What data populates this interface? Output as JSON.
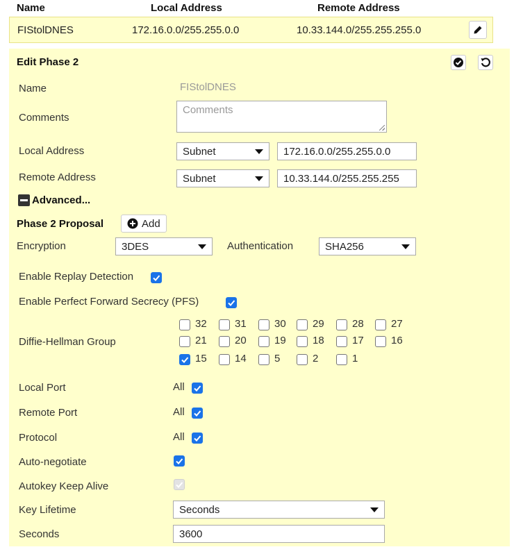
{
  "table": {
    "headers": [
      "Name",
      "Local Address",
      "Remote Address"
    ],
    "row": {
      "name": "FIStolDNES",
      "local": "172.16.0.0/255.255.0.0",
      "remote": "10.33.144.0/255.255.255.0"
    }
  },
  "edit": {
    "title": "Edit Phase 2",
    "name_label": "Name",
    "name_value": "FIStolDNES",
    "comments_label": "Comments",
    "comments_placeholder": "Comments",
    "local_address_label": "Local Address",
    "local_address_type": "Subnet",
    "local_address_value": "172.16.0.0/255.255.0.0",
    "remote_address_label": "Remote Address",
    "remote_address_type": "Subnet",
    "remote_address_value": "10.33.144.0/255.255.255",
    "advanced_label": "Advanced...",
    "proposal_label": "Phase 2 Proposal",
    "add_label": "Add",
    "encryption_label": "Encryption",
    "encryption_value": "3DES",
    "authentication_label": "Authentication",
    "authentication_value": "SHA256",
    "replay_label": "Enable Replay Detection",
    "replay_checked": true,
    "pfs_label": "Enable Perfect Forward Secrecy (PFS)",
    "pfs_checked": true,
    "dh_label": "Diffie-Hellman Group",
    "dh_groups": [
      {
        "value": "32",
        "checked": false
      },
      {
        "value": "31",
        "checked": false
      },
      {
        "value": "30",
        "checked": false
      },
      {
        "value": "29",
        "checked": false
      },
      {
        "value": "28",
        "checked": false
      },
      {
        "value": "27",
        "checked": false
      },
      {
        "value": "21",
        "checked": false
      },
      {
        "value": "20",
        "checked": false
      },
      {
        "value": "19",
        "checked": false
      },
      {
        "value": "18",
        "checked": false
      },
      {
        "value": "17",
        "checked": false
      },
      {
        "value": "16",
        "checked": false
      },
      {
        "value": "15",
        "checked": true
      },
      {
        "value": "14",
        "checked": false
      },
      {
        "value": "5",
        "checked": false
      },
      {
        "value": "2",
        "checked": false
      },
      {
        "value": "1",
        "checked": false
      }
    ],
    "local_port_label": "Local Port",
    "local_port_all": "All",
    "remote_port_label": "Remote Port",
    "remote_port_all": "All",
    "protocol_label": "Protocol",
    "protocol_all": "All",
    "autoneg_label": "Auto-negotiate",
    "keepalive_label": "Autokey Keep Alive",
    "key_lifetime_label": "Key Lifetime",
    "key_lifetime_value": "Seconds",
    "seconds_label": "Seconds",
    "seconds_value": "3600"
  },
  "colors": {
    "panel_bg": "#ffffcc",
    "checkbox_on": "#1a73e8"
  }
}
